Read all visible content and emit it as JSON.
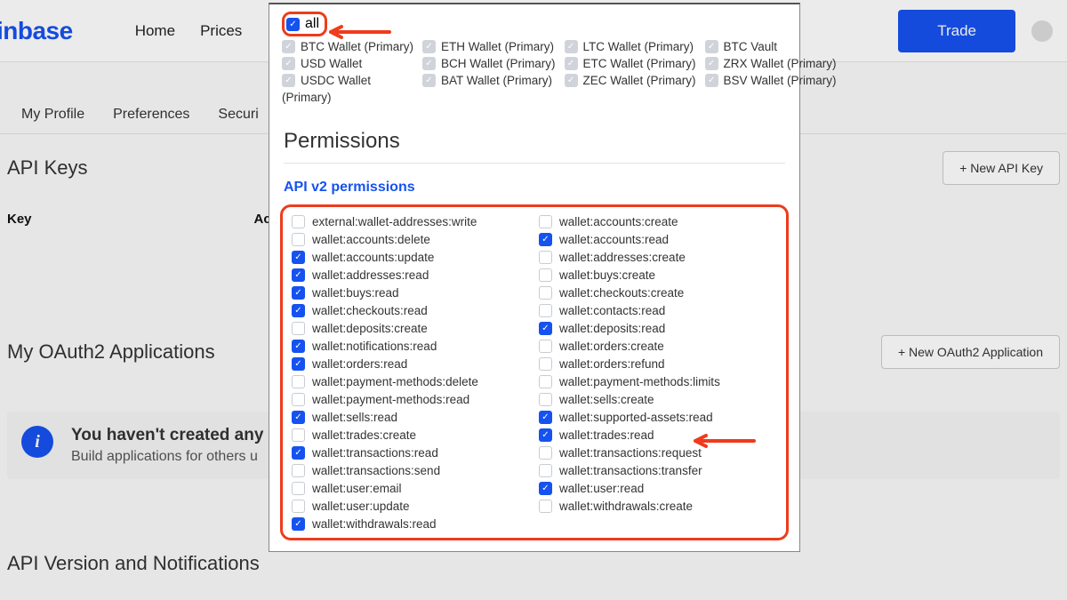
{
  "topbar": {
    "logo": "inbase",
    "nav": [
      "Home",
      "Prices"
    ],
    "trade": "Trade"
  },
  "tabs": [
    "My Profile",
    "Preferences",
    "Securi"
  ],
  "api_keys": {
    "title": "API Keys",
    "button": "+ New API Key",
    "cols": [
      "Key",
      "Ac"
    ]
  },
  "oauth": {
    "title": "My OAuth2 Applications",
    "button": "+ New OAuth2 Application",
    "banner_title": "You haven't created any OA",
    "banner_sub": "Build applications for others u"
  },
  "api_version_title": "API Version and Notifications",
  "modal": {
    "all_label": "all",
    "accounts": [
      "BTC Wallet (Primary)",
      "ETH Wallet (Primary)",
      "LTC Wallet (Primary)",
      "BTC Vault",
      "USD Wallet",
      "BCH Wallet (Primary)",
      "ETC Wallet (Primary)",
      "ZRX Wallet (Primary)",
      "USDC Wallet",
      "BAT Wallet (Primary)",
      "ZEC Wallet (Primary)",
      "BSV Wallet (Primary)"
    ],
    "accounts_tail": "(Primary)",
    "permissions_heading": "Permissions",
    "api_v2_label": "API v2 permissions",
    "permissions": [
      {
        "label": "external:wallet-addresses:write",
        "checked": false
      },
      {
        "label": "wallet:accounts:create",
        "checked": false
      },
      {
        "label": "wallet:accounts:delete",
        "checked": false
      },
      {
        "label": "wallet:accounts:read",
        "checked": true
      },
      {
        "label": "wallet:accounts:update",
        "checked": true
      },
      {
        "label": "wallet:addresses:create",
        "checked": false
      },
      {
        "label": "wallet:addresses:read",
        "checked": true
      },
      {
        "label": "wallet:buys:create",
        "checked": false
      },
      {
        "label": "wallet:buys:read",
        "checked": true
      },
      {
        "label": "wallet:checkouts:create",
        "checked": false
      },
      {
        "label": "wallet:checkouts:read",
        "checked": true
      },
      {
        "label": "wallet:contacts:read",
        "checked": false
      },
      {
        "label": "wallet:deposits:create",
        "checked": false
      },
      {
        "label": "wallet:deposits:read",
        "checked": true
      },
      {
        "label": "wallet:notifications:read",
        "checked": true
      },
      {
        "label": "wallet:orders:create",
        "checked": false
      },
      {
        "label": "wallet:orders:read",
        "checked": true
      },
      {
        "label": "wallet:orders:refund",
        "checked": false
      },
      {
        "label": "wallet:payment-methods:delete",
        "checked": false
      },
      {
        "label": "wallet:payment-methods:limits",
        "checked": false
      },
      {
        "label": "wallet:payment-methods:read",
        "checked": false
      },
      {
        "label": "wallet:sells:create",
        "checked": false
      },
      {
        "label": "wallet:sells:read",
        "checked": true
      },
      {
        "label": "wallet:supported-assets:read",
        "checked": true
      },
      {
        "label": "wallet:trades:create",
        "checked": false
      },
      {
        "label": "wallet:trades:read",
        "checked": true
      },
      {
        "label": "wallet:transactions:read",
        "checked": true
      },
      {
        "label": "wallet:transactions:request",
        "checked": false
      },
      {
        "label": "wallet:transactions:send",
        "checked": false
      },
      {
        "label": "wallet:transactions:transfer",
        "checked": false
      },
      {
        "label": "wallet:user:email",
        "checked": false
      },
      {
        "label": "wallet:user:read",
        "checked": true
      },
      {
        "label": "wallet:user:update",
        "checked": false
      },
      {
        "label": "wallet:withdrawals:create",
        "checked": false
      },
      {
        "label": "wallet:withdrawals:read",
        "checked": true
      }
    ]
  }
}
